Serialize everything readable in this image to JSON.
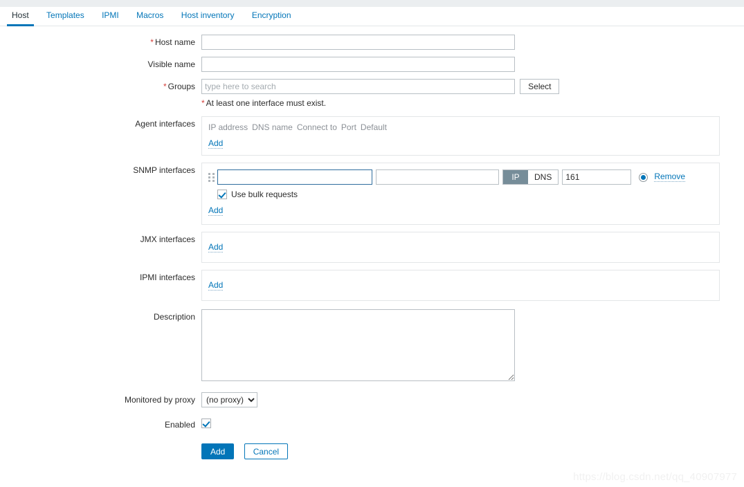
{
  "tabs": [
    {
      "label": "Host",
      "active": true
    },
    {
      "label": "Templates",
      "active": false
    },
    {
      "label": "IPMI",
      "active": false
    },
    {
      "label": "Macros",
      "active": false
    },
    {
      "label": "Host inventory",
      "active": false
    },
    {
      "label": "Encryption",
      "active": false
    }
  ],
  "form": {
    "host_name": {
      "label": "Host name",
      "required": true,
      "value": "",
      "placeholder": ""
    },
    "visible_name": {
      "label": "Visible name",
      "required": false,
      "value": "",
      "placeholder": ""
    },
    "groups": {
      "label": "Groups",
      "required": true,
      "value": "",
      "placeholder": "type here to search",
      "select_button": "Select"
    },
    "interface_note": "At least one interface must exist.",
    "agent_interfaces": {
      "label": "Agent interfaces",
      "columns": [
        "IP address",
        "DNS name",
        "Connect to",
        "Port",
        "Default"
      ],
      "add_label": "Add"
    },
    "snmp_interfaces": {
      "label": "SNMP interfaces",
      "add_label": "Add",
      "row": {
        "ip_value": "",
        "dns_value": "",
        "connect_to": [
          "IP",
          "DNS"
        ],
        "connect_to_selected": "IP",
        "port_value": "161",
        "default_selected": true,
        "remove_label": "Remove",
        "bulk_label": "Use bulk requests",
        "bulk_checked": true
      }
    },
    "jmx_interfaces": {
      "label": "JMX interfaces",
      "add_label": "Add"
    },
    "ipmi_interfaces": {
      "label": "IPMI interfaces",
      "add_label": "Add"
    },
    "description": {
      "label": "Description",
      "value": ""
    },
    "monitored_by_proxy": {
      "label": "Monitored by proxy",
      "selected": "(no proxy)",
      "options": [
        "(no proxy)"
      ]
    },
    "enabled": {
      "label": "Enabled",
      "checked": true
    }
  },
  "actions": {
    "submit_label": "Add",
    "cancel_label": "Cancel"
  },
  "watermark": "https://blog.csdn.net/qq_40907977",
  "colors": {
    "accent": "#0275b8",
    "required": "#d43f3a",
    "toggle_selected_bg": "#768d99"
  }
}
